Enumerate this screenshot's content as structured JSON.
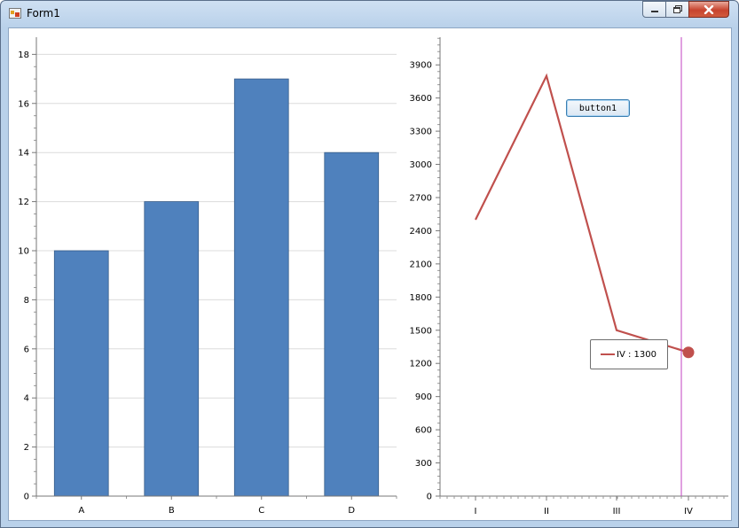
{
  "window": {
    "title": "Form1"
  },
  "button1": {
    "label": "button1"
  },
  "tooltip": {
    "label": "IV : 1300"
  },
  "chart_data": [
    {
      "type": "bar",
      "categories": [
        "A",
        "B",
        "C",
        "D"
      ],
      "values": [
        10,
        12,
        17,
        14
      ],
      "ylim": [
        0,
        18.7
      ],
      "yticks": [
        0,
        2,
        4,
        6,
        8,
        10,
        12,
        14,
        16,
        18
      ],
      "grid": true,
      "colors": {
        "bar": "#4f81bd",
        "bar_edge": "#385d8a"
      }
    },
    {
      "type": "line",
      "categories": [
        "I",
        "II",
        "III",
        "IV"
      ],
      "values": [
        2500,
        3800,
        1500,
        1300
      ],
      "ylim": [
        0,
        4150
      ],
      "yticks": [
        0,
        300,
        600,
        900,
        1200,
        1500,
        1800,
        2100,
        2400,
        2700,
        3000,
        3300,
        3600,
        3900
      ],
      "grid": false,
      "cursor_at": "IV",
      "colors": {
        "line": "#c0504d",
        "cursor": "#c040c0"
      }
    }
  ]
}
